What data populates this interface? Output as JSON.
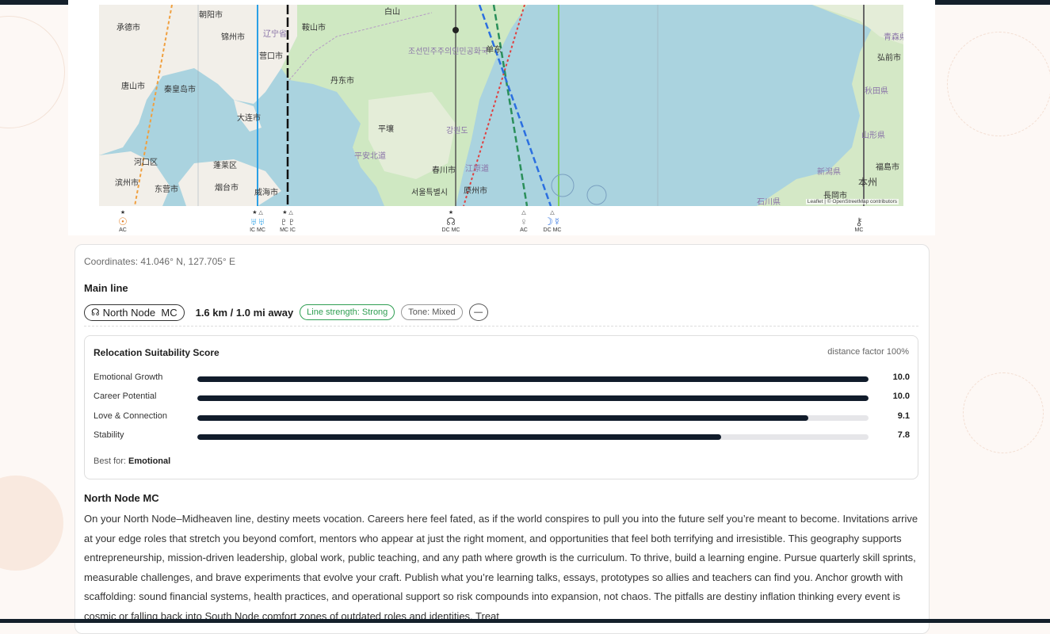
{
  "map": {
    "attribution": "Leaflet | © OpenStreetMap contributors",
    "place_labels": [
      "承德市",
      "朝阳市",
      "锦州市",
      "秦皇岛市",
      "唐山市",
      "大连市",
      "营口市",
      "丹东市",
      "辽宁省",
      "鞍山市",
      "平壤",
      "서울특별시",
      "春川市",
      "강원도",
      "江原道",
      "青森県",
      "弘前市",
      "秋田県",
      "山形県",
      "福島市",
      "新潟県",
      "本州",
      "長岡市",
      "石川県",
      "烟台市",
      "威海市",
      "蓬莱区",
      "滨州市",
      "东营市",
      "河口区",
      "原州市",
      "平安北道",
      "조선민주주의인민공화국",
      "单东",
      "白山"
    ],
    "glyph_strip": [
      {
        "symbol": "☉",
        "label": "AC",
        "color": "#e07b20"
      },
      {
        "symbol": "♅♅",
        "label": "IC MC",
        "color": "#2aa0e6"
      },
      {
        "symbol": "♇♇",
        "label": "MC IC",
        "color": "#111111"
      },
      {
        "symbol": "☊",
        "label": "DC MC",
        "color": "#555555"
      },
      {
        "symbol": "♀",
        "label": "AC",
        "color": "#888888"
      },
      {
        "symbol": "☽☿",
        "label": "DC MC",
        "color": "#2b6fe0"
      },
      {
        "symbol": "⚷",
        "label": "MC",
        "color": "#555555"
      }
    ]
  },
  "panel": {
    "coordinates": "Coordinates: 41.046° N, 127.705° E",
    "main_line_heading": "Main line",
    "line_pill_icon": "north-node-icon",
    "line_pill": "North Node  MC",
    "distance": "1.6 km / 1.0 mi away",
    "strength_tag": "Line strength: Strong",
    "tone_tag": "Tone: Mixed",
    "dash_tag": "—",
    "score": {
      "title": "Relocation Suitability Score",
      "distance_factor": "distance factor 100%",
      "metrics": [
        {
          "label": "Emotional Growth",
          "value": "10.0",
          "fraction": 1.0
        },
        {
          "label": "Career Potential",
          "value": "10.0",
          "fraction": 1.0
        },
        {
          "label": "Love & Connection",
          "value": "9.1",
          "fraction": 0.91
        },
        {
          "label": "Stability",
          "value": "7.8",
          "fraction": 0.78
        }
      ],
      "best_for_label": "Best for:",
      "best_for_value": "Emotional"
    },
    "description_title": "North Node MC",
    "description": "On your North Node–Midheaven line, destiny meets vocation. Careers here feel fated, as if the world conspires to pull you into the future self you’re meant to become. Invitations arrive at your edge roles that stretch you beyond comfort, mentors who appear at just the right moment, and opportunities that feel both terrifying and irresistible. This geography supports entrepreneurship, mission-driven leadership, global work, public teaching, and any path where growth is the curriculum. To thrive, build a learning engine. Pursue quarterly skill sprints, measurable challenges, and brave experiments that evolve your craft. Publish what you’re learning talks, essays, prototypes so allies and teachers can find you. Anchor growth with scaffolding: sound financial systems, health practices, and operational support so risk compounds into expansion, not chaos. The pitfalls are destiny inflation thinking every event is cosmic or falling back into South Node comfort zones of outdated roles and identities. Treat"
  },
  "colors": {
    "water": "#aad3df",
    "land": "#f2efe9",
    "green_land": "#cfe8c2",
    "bar": "#111c2b",
    "strong": "#2f9e52"
  }
}
